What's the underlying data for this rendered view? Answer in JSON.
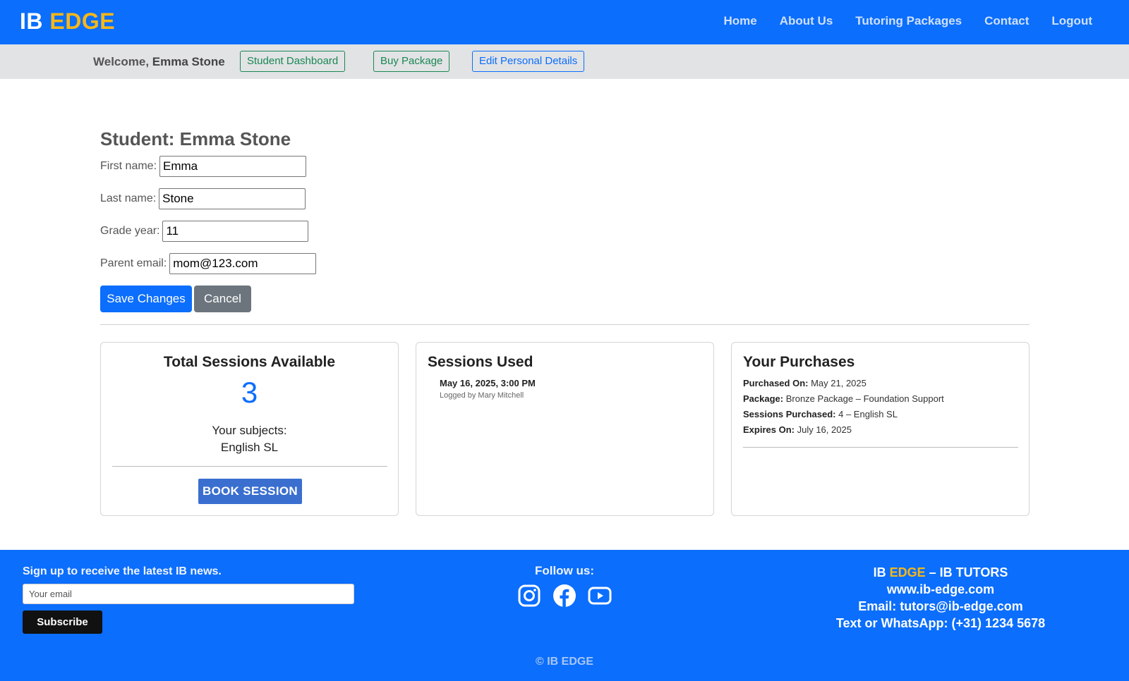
{
  "brand": {
    "ib": "IB",
    "edge": "EDGE"
  },
  "nav": {
    "home": "Home",
    "about": "About Us",
    "packages": "Tutoring Packages",
    "contact": "Contact",
    "logout": "Logout"
  },
  "subbar": {
    "welcome_prefix": "Welcome, ",
    "user_name": "Emma Stone",
    "dashboard": "Student Dashboard",
    "buy_package": "Buy Package",
    "edit_details": "Edit Personal Details"
  },
  "student": {
    "title": "Student: Emma Stone",
    "first_name_label": "First name:",
    "first_name": "Emma",
    "last_name_label": "Last name:",
    "last_name": "Stone",
    "grade_label": "Grade year:",
    "grade": "11",
    "parent_email_label": "Parent email:",
    "parent_email": "mom@123.com",
    "save": "Save Changes",
    "cancel": "Cancel"
  },
  "sessions_available": {
    "title": "Total Sessions Available",
    "count": "3",
    "subjects_label": "Your subjects:",
    "subjects": "English SL",
    "book": "BOOK SESSION"
  },
  "sessions_used": {
    "title": "Sessions Used",
    "entries": [
      {
        "date": "May 16, 2025, 3:00 PM",
        "logged_by": "Logged by Mary Mitchell"
      }
    ]
  },
  "purchases": {
    "title": "Your Purchases",
    "purchased_on_label": "Purchased On:",
    "purchased_on": "May 21, 2025",
    "package_label": "Package:",
    "package": "Bronze Package – Foundation Support",
    "sessions_label": "Sessions Purchased:",
    "sessions": "4 – English SL",
    "expires_label": "Expires On:",
    "expires": "July 16, 2025"
  },
  "footer": {
    "signup_text": "Sign up to receive the latest IB news.",
    "email_placeholder": "Your email",
    "subscribe": "Subscribe",
    "follow": "Follow us:",
    "socials": [
      "instagram-icon",
      "facebook-icon",
      "youtube-icon"
    ],
    "contact_ib": "IB ",
    "contact_edge": "EDGE",
    "contact_suffix": " – IB TUTORS",
    "website": "www.ib-edge.com",
    "email": "Email: tutors@ib-edge.com",
    "phone": "Text or WhatsApp: (+31) 1234 5678",
    "copyright": "© IB EDGE"
  },
  "colors": {
    "primary": "#0b6efd",
    "accent": "#f5b71a",
    "success": "#198754",
    "secondary": "#6c757d"
  }
}
